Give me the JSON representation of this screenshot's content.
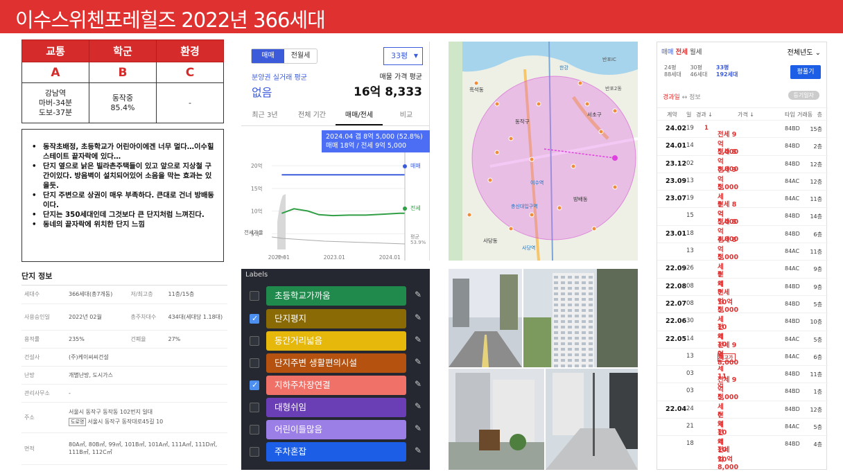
{
  "header": {
    "title": "이수스위첸포레힐즈  2022년 366세대"
  },
  "score_table": {
    "headers": [
      "교통",
      "학군",
      "환경"
    ],
    "grades": [
      "A",
      "B",
      "C"
    ],
    "details": [
      [
        "강남역",
        "마버-34분",
        "도보-37분"
      ],
      [
        "동작중",
        "85.4%"
      ],
      [
        "-"
      ]
    ]
  },
  "notes": [
    "동작초배정, 초등학교가 어린아이에겐 너무 멀다…이수힐스테이트 끝자락에 있다…",
    "단지 옆으로 낡은 빌라촌주택들이 있고 앞으로 지상철 구간이있다. 방음벽이 설치되어있어 소음을 막는 효과는 있을듯.",
    "단지 주변으로 상권이 매우 부족하다. 큰대로 건너 방배동이다.",
    "단지는 350세대인데 그것보다 큰 단지처럼 느껴진다.",
    "동네의 끝자락에 위치한 단지 느낌"
  ],
  "complex_info": {
    "title": "단지 정보",
    "rows": [
      {
        "k1": "세대수",
        "v1": "366세대(총7개동)",
        "k2": "저/최고층",
        "v2": "11층/15층"
      },
      {
        "k1": "사용승인일",
        "v1": "2022년 02월",
        "k2": "총주차대수",
        "v2": "434대(세대당 1.18대)"
      },
      {
        "k1": "용적률",
        "v1": "235%",
        "k2": "건폐율",
        "v2": "27%"
      },
      {
        "k1": "건설사",
        "v1": "(주)케이씨씨건설"
      },
      {
        "k1": "난방",
        "v1": "개별난방, 도시가스"
      },
      {
        "k1": "관리사무소",
        "v1": "-"
      },
      {
        "k1": "주소",
        "v1": "서울시 동작구 동작동 102번지 일대",
        "road_tag": "도로명",
        "v1b": "서울시 동작구 동작대로45길 10"
      },
      {
        "k1": "면적",
        "v1": "80A㎡, 80B㎡, 99㎡, 101B㎡, 101A㎡, 111A㎡, 111D㎡, 111B㎡, 112C㎡"
      }
    ]
  },
  "price_panel": {
    "seg_on": "매매",
    "seg_off": "전월세",
    "pyung": "33평",
    "left_label": "분양권 실거래 평균",
    "left_value": "없음",
    "right_label": "매물 가격 평균",
    "right_value": "16억 8,333",
    "tabs": [
      "최근 3년",
      "전체 기간",
      "매매/전세",
      "비교"
    ],
    "tooltip_line1": "2024.04  갭 8억 5,000 (52.8%)",
    "tooltip_line2": "매매 18억 / 전세 9억 5,000",
    "series_labels": {
      "sale": "매매",
      "jeonse": "전세",
      "ratio": "평균",
      "ratio_val": "53.9%"
    },
    "jeonse_ratio_label": "전세가율"
  },
  "chart_data": {
    "type": "line",
    "x_ticks": [
      "2022.01",
      "2023.01",
      "2024.01"
    ],
    "y_ticks": [
      "20억",
      "15억",
      "10억",
      "5억"
    ],
    "ylim": [
      0,
      22
    ],
    "series": [
      {
        "name": "매매",
        "color": "#3b5bdb",
        "points": [
          [
            2022.08,
            18
          ],
          [
            2024.3,
            18
          ]
        ]
      },
      {
        "name": "전세",
        "color": "#2f9e44",
        "points": [
          [
            2022.08,
            9.5
          ],
          [
            2022.3,
            10.5
          ],
          [
            2022.55,
            10
          ],
          [
            2022.75,
            9.2
          ],
          [
            2023.0,
            9
          ],
          [
            2023.3,
            9.1
          ],
          [
            2023.6,
            9.1
          ],
          [
            2023.9,
            9.3
          ],
          [
            2024.2,
            9.5
          ],
          [
            2024.3,
            9.5
          ]
        ]
      }
    ]
  },
  "map": {
    "labels": [
      "한강",
      "반포IC",
      "반포2동",
      "서초구",
      "동작구",
      "방배동",
      "이수역",
      "총신대입구역",
      "사당역",
      "사당동",
      "흑석동"
    ]
  },
  "labels_panel": {
    "title": "Labels",
    "items": [
      {
        "text": "초등학교가까움",
        "color": "#1f8a4c",
        "checked": false
      },
      {
        "text": "단지평지",
        "color": "#8a6a05",
        "checked": true
      },
      {
        "text": "동간거리넓음",
        "color": "#e5b80b",
        "checked": false
      },
      {
        "text": "단지주변 생활편의시설",
        "color": "#b5520f",
        "checked": false
      },
      {
        "text": "지하주차장연결",
        "color": "#f07167",
        "checked": true
      },
      {
        "text": "대형쉬임",
        "color": "#6a3fb5",
        "checked": false
      },
      {
        "text": "어린이들많음",
        "color": "#9b7ee6",
        "checked": false
      },
      {
        "text": "주차혼잡",
        "color": "#1c5fe6",
        "checked": false
      }
    ]
  },
  "tx_panel": {
    "tabs": [
      "매매",
      "전세",
      "월세"
    ],
    "year_filter": "전체년도 ⌄",
    "types": [
      {
        "p": "24평",
        "h": "88세대"
      },
      {
        "p": "30평",
        "h": "46세대"
      },
      {
        "p": "33평",
        "h": "192세대",
        "sel": true
      }
    ],
    "btn": "평풀기",
    "sub_red": "경과일",
    "sub_gray": "↔ 정보",
    "reg_btn": "등기일자",
    "headers": [
      "계약",
      "일",
      "경과 ↓",
      "가격 ↓",
      "타입",
      "거래동",
      "층"
    ],
    "rows": [
      {
        "ym": "24.02",
        "d": "19",
        "n": "1",
        "price": "전세 9억 5,000",
        "type": "84BD",
        "floor": "15층"
      },
      {
        "ym": "24.01",
        "d": "14",
        "n": "",
        "price": "전세 8억 8,000",
        "type": "84BD",
        "floor": "2층"
      },
      {
        "ym": "23.12",
        "d": "02",
        "n": "",
        "price": "전세 9억 5,000",
        "type": "84BD",
        "floor": "12층"
      },
      {
        "ym": "23.09",
        "d": "13",
        "n": "",
        "price": "전세 9억",
        "type": "84AC",
        "floor": "12층"
      },
      {
        "ym": "23.07",
        "d": "19",
        "n": "",
        "price": "전세 8억 5,000",
        "type": "84AC",
        "floor": "11층"
      },
      {
        "ym": "",
        "d": "15",
        "n": "",
        "price": "전세 8억 4,000",
        "type": "84BD",
        "floor": "14층"
      },
      {
        "ym": "23.01",
        "d": "18",
        "n": "",
        "price": "전세 8억 5,000",
        "type": "84BD",
        "floor": "6층"
      },
      {
        "ym": "",
        "d": "13",
        "n": "",
        "price": "전세 9억",
        "type": "84AC",
        "floor": "11층"
      },
      {
        "ym": "22.09",
        "d": "26",
        "n": "",
        "price": "전세 9억",
        "type": "84AC",
        "floor": "9층"
      },
      {
        "ym": "22.08",
        "d": "08",
        "n": "",
        "price": "전세 10억 5,000",
        "type": "84BD",
        "floor": "9층"
      },
      {
        "ym": "22.07",
        "d": "08",
        "n": "",
        "price": "전세 10억",
        "type": "84BD",
        "floor": "5층"
      },
      {
        "ym": "22.06",
        "d": "30",
        "n": "",
        "price": "전세 10억",
        "type": "84BD",
        "floor": "10층"
      },
      {
        "ym": "22.05",
        "d": "14",
        "n": "",
        "price": "전세 9억 8,000",
        "type": "84AC",
        "floor": "5층"
      },
      {
        "ym": "",
        "d": "13",
        "n": "",
        "price": "전세 11억",
        "tag": "최고가",
        "type": "84AC",
        "floor": "6층"
      },
      {
        "ym": "",
        "d": "03",
        "n": "",
        "price": "전세 9억 5,000",
        "type": "84BD",
        "floor": "11층"
      },
      {
        "ym": "",
        "d": "03",
        "n": "",
        "price": "전세 6억",
        "type": "84BD",
        "floor": "1층"
      },
      {
        "ym": "22.04",
        "d": "24",
        "n": "",
        "price": "전세 10억",
        "type": "84BD",
        "floor": "12층"
      },
      {
        "ym": "",
        "d": "21",
        "n": "",
        "price": "전세 10억",
        "type": "84AC",
        "floor": "5층"
      },
      {
        "ym": "",
        "d": "18",
        "n": "",
        "price": "전세 10억 8,000",
        "type": "84BD",
        "floor": "4층"
      }
    ]
  }
}
